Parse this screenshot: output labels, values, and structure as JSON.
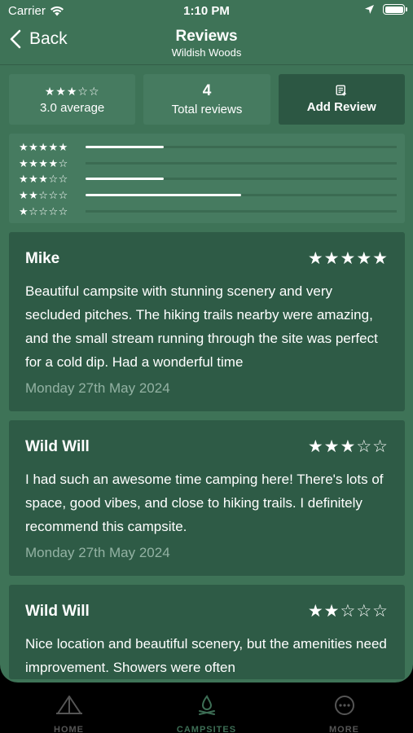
{
  "status_bar": {
    "carrier": "Carrier",
    "time": "1:10 PM"
  },
  "nav": {
    "back_label": "Back",
    "title": "Reviews",
    "subtitle": "Wildish Woods"
  },
  "summary": {
    "average_stars": "★★★☆☆",
    "average_label": "3.0 average",
    "total_count": "4",
    "total_label": "Total reviews",
    "add_label": "Add Review"
  },
  "distribution": [
    {
      "stars": "★★★★★",
      "fraction": 0.25
    },
    {
      "stars": "★★★★☆",
      "fraction": 0
    },
    {
      "stars": "★★★☆☆",
      "fraction": 0.25
    },
    {
      "stars": "★★☆☆☆",
      "fraction": 0.5
    },
    {
      "stars": "★☆☆☆☆",
      "fraction": 0
    }
  ],
  "reviews": [
    {
      "name": "Mike",
      "stars": "★★★★★",
      "text": "Beautiful campsite with stunning scenery and very secluded pitches. The hiking trails nearby were amazing, and the small stream running through the site was perfect for a cold dip. Had a wonderful time",
      "date": "Monday 27th May 2024"
    },
    {
      "name": "Wild Will",
      "stars": "★★★☆☆",
      "text": "I had such an awesome time camping here! There's lots of space, good vibes, and close to hiking trails. I definitely recommend this campsite.",
      "date": "Monday 27th May 2024"
    },
    {
      "name": "Wild Will",
      "stars": "★★☆☆☆",
      "text": "Nice location and beautiful scenery, but the amenities need improvement. Showers were often",
      "date": ""
    }
  ],
  "tabs": [
    {
      "label": "HOME",
      "icon": "tent-icon",
      "active": false
    },
    {
      "label": "CAMPSITES",
      "icon": "campfire-icon",
      "active": true
    },
    {
      "label": "MORE",
      "icon": "more-icon",
      "active": false
    }
  ],
  "colors": {
    "background": "#3e7357",
    "card": "#467b60",
    "review_card": "#2e5b46",
    "accent": "#3d6e55",
    "date_text": "#93b2a3"
  }
}
